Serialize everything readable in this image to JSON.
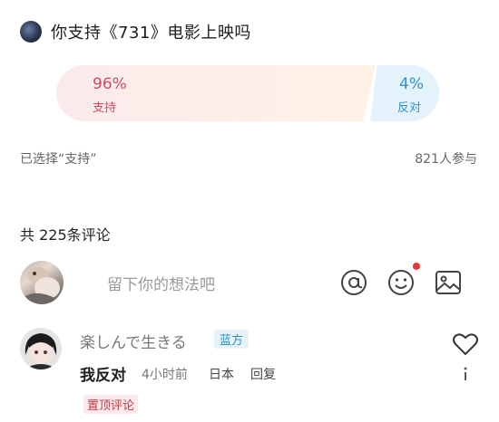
{
  "poll": {
    "title": "你支持《731》电影上映吗",
    "support": {
      "percent": "96%",
      "label": "支持",
      "value": 0.96,
      "color": "#d24a5e"
    },
    "oppose": {
      "percent": "4%",
      "label": "反对",
      "value": 0.04,
      "color": "#2f8fd0"
    },
    "selected": "已选择“支持”",
    "participants": "821人参与"
  },
  "comments": {
    "count_label": "共 225条评论",
    "input_placeholder": "留下你的想法吧",
    "icons": [
      "at-icon",
      "emoji-icon",
      "image-icon"
    ],
    "items": [
      {
        "username": "楽しんで生きる",
        "badge": "蓝方",
        "text": "我反对",
        "time": "4小时前",
        "location": "日本",
        "reply": "回复",
        "pinned": "置顶评论"
      }
    ]
  }
}
